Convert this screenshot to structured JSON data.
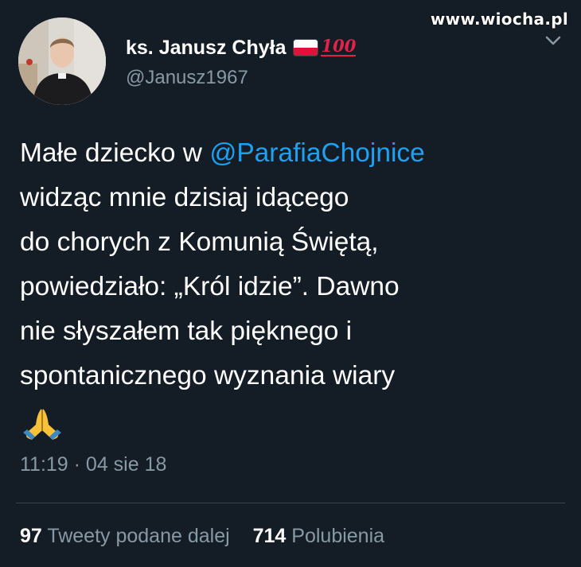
{
  "watermark": "www.wiocha.pl",
  "author": {
    "display_name": "ks. Janusz Chyła",
    "handle": "@Janusz1967",
    "badge_100": "100"
  },
  "tweet": {
    "lines": [
      {
        "before": "Małe dziecko w ",
        "mention": "@ParafiaChojnice"
      },
      {
        "text": "widząc mnie dzisiaj idącego"
      },
      {
        "text": "do chorych z Komunią Świętą,"
      },
      {
        "text": "powiedziało: „Król idzie”. Dawno"
      },
      {
        "text": "nie słyszałem tak pięknego i"
      },
      {
        "text": "spontanicznego wyznania wiary"
      }
    ],
    "emoji": "folded-hands",
    "timestamp": "11:19 · 04 sie 18"
  },
  "stats": {
    "retweets_count": "97",
    "retweets_label": "Tweety podane dalej",
    "likes_count": "714",
    "likes_label": "Polubienia"
  },
  "colors": {
    "background": "#141d26",
    "mention": "#1da1f2",
    "muted": "#8899a6",
    "divider": "#38444d"
  }
}
